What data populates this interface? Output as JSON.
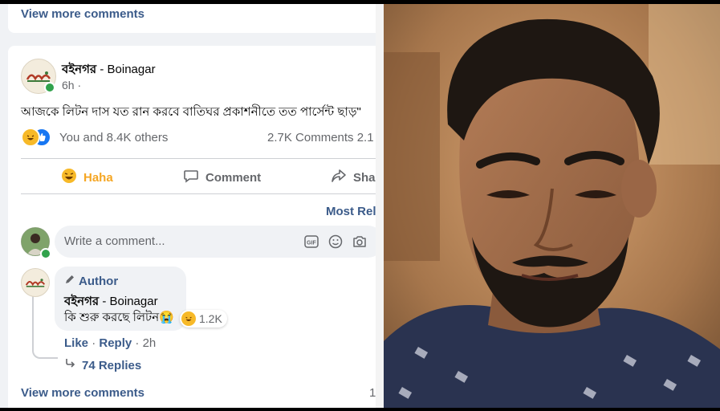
{
  "top_card": {
    "view_more_comments": "View more comments"
  },
  "post": {
    "page_name": "বইনগর",
    "page_name_latin": " - Boinagar",
    "time": "6h ·",
    "text": "আজকে লিটন দাস যত রান করবে বাতিঘর প্রকাশনীতে তত পার্সেন্ট ছাড়\"",
    "reactions_text": "You and 8.4K others",
    "comments_shares": "2.7K Comments  2.1",
    "actions": {
      "haha": "Haha",
      "comment": "Comment",
      "share": "Share"
    },
    "sort_label": "Most Relevant"
  },
  "composer": {
    "placeholder": "Write a comment..."
  },
  "comment": {
    "badge": "Author",
    "name": "বইনগর",
    "name_latin": " - Boinagar",
    "text": "কি শুরু করছে লিটন😭",
    "reaction_count": "1.2K",
    "like": "Like",
    "reply": "Reply",
    "time": "2h",
    "replies": "74 Replies"
  },
  "footer": {
    "view_more_comments": "View more comments",
    "count": "1"
  },
  "colors": {
    "link": "#3b5b8a",
    "haha": "#f7b928",
    "like": "#1877f2",
    "online": "#31a24c"
  },
  "icons": [
    "haha-icon",
    "like-icon",
    "comment-icon",
    "share-icon",
    "gif-icon",
    "smile-icon",
    "camera-icon",
    "pencil-icon",
    "reply-arrow-icon"
  ]
}
